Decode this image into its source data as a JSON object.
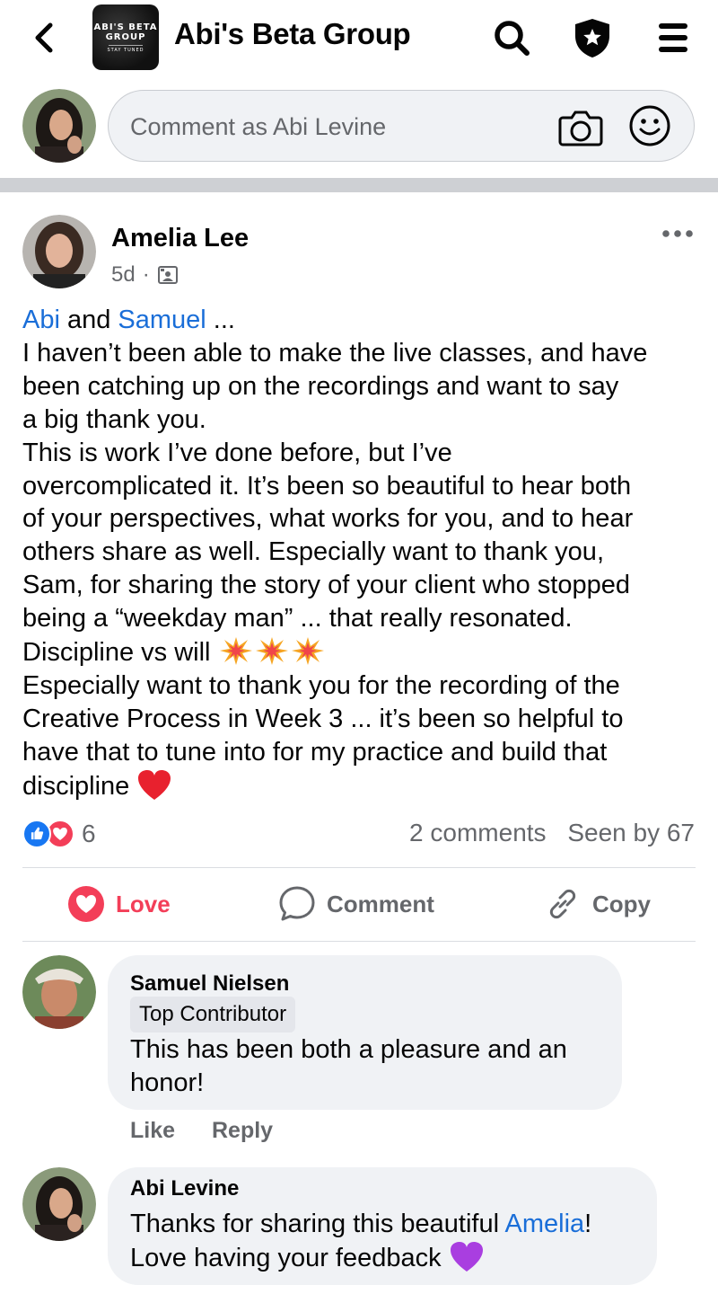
{
  "header": {
    "title": "Abi's Beta Group",
    "thumb_line1": "ABI'S BETA",
    "thumb_line2": "GROUP",
    "thumb_line3": "STAY TUNED",
    "icons": [
      "back-chevron-icon",
      "search-icon",
      "shield-star-icon",
      "menu-icon"
    ]
  },
  "composer": {
    "placeholder": "Comment as Abi Levine",
    "icons": [
      "camera-icon",
      "smiley-icon"
    ]
  },
  "post": {
    "author": "Amelia Lee",
    "age": "5d",
    "dot": "·",
    "mention1": "Abi",
    "and": " and ",
    "mention2": "Samuel",
    "ellipsis": " ...",
    "lines": [
      "I haven’t been able to make the live classes, and have",
      "been catching up on the recordings and want to say",
      "a big thank you.",
      "This is work I’ve done before, but I’ve",
      "overcomplicated it. It’s been so beautiful to hear both",
      "of your perspectives, what works for you, and to hear",
      "others share as well. Especially want to thank you,",
      "Sam, for sharing the story of your client who stopped",
      "being a “weekday man” ... that really resonated.",
      "Discipline vs will ",
      "Especially want to thank you for the recording of the",
      "Creative Process in Week 3 ... it’s been so helpful to",
      "have that to tune into for my practice and build that",
      "discipline "
    ],
    "reaction_count": "6",
    "comments_count": "2 comments",
    "seen_by": "Seen by 67"
  },
  "actions": {
    "love": "Love",
    "comment": "Comment",
    "copy": "Copy"
  },
  "comments": [
    {
      "name": "Samuel Nielsen",
      "badge": "Top Contributor",
      "line1": "This has been both a pleasure and an",
      "line2": "honor!",
      "like": "Like",
      "reply": "Reply"
    },
    {
      "name": "Abi Levine",
      "line1_pre": "Thanks for sharing this beautiful ",
      "line1_mention": "Amelia",
      "line1_post": "!",
      "line2": "Love having your feedback "
    }
  ],
  "colors": {
    "mention": "#1a6ed8",
    "love": "#f33e58",
    "like": "#1877f2",
    "secondary_text": "#65676b",
    "bubble": "#f0f2f5"
  }
}
